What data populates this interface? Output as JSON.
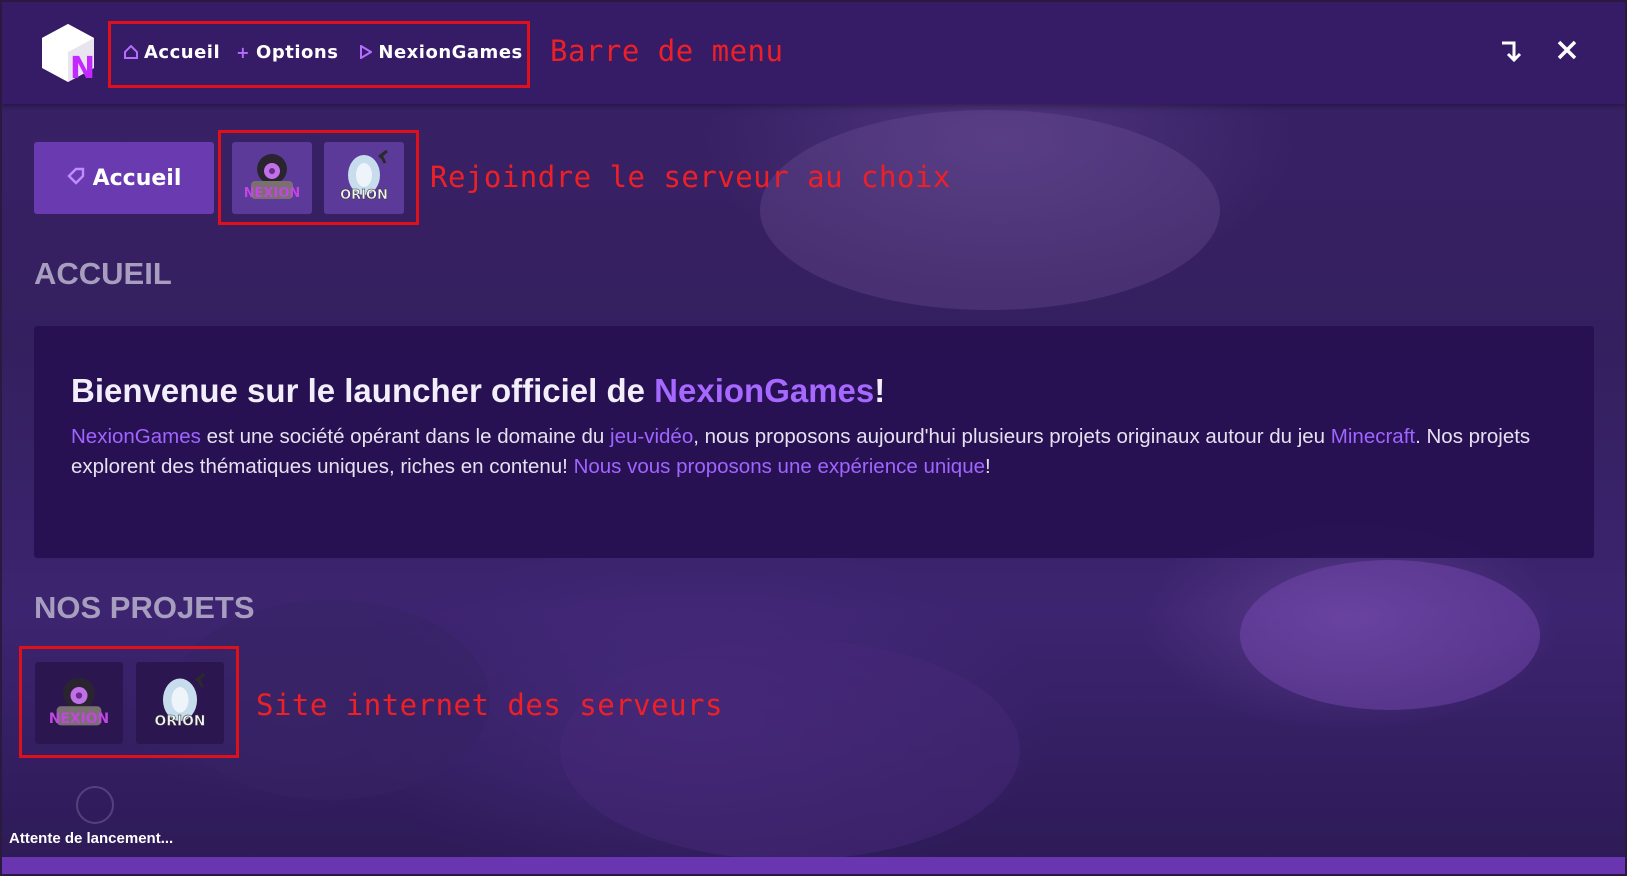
{
  "menu": {
    "items": [
      {
        "label": "Accueil",
        "icon": "home-icon"
      },
      {
        "label": "Options",
        "icon": "plus-icon"
      },
      {
        "label": "NexionGames",
        "icon": "play-icon"
      }
    ]
  },
  "window": {
    "minimize_icon": "arrow-down-icon",
    "close_icon": "close-icon"
  },
  "annotations": {
    "menu_bar": "Barre de menu",
    "join_server": "Rejoindre le serveur au choix",
    "websites": "Site internet des serveurs"
  },
  "tabs": {
    "home_label": "Accueil",
    "servers": [
      {
        "name": "Nexion"
      },
      {
        "name": "Orion"
      }
    ]
  },
  "home": {
    "section_title": "ACCUEIL",
    "welcome_prefix": "Bienvenue sur le launcher officiel de ",
    "welcome_brand": "NexionGames",
    "welcome_suffix": "!",
    "p_brand": "NexionGames",
    "p_text1": " est une société opérant dans le domaine du ",
    "p_link_jeu": "jeu-vidéo",
    "p_text2": ", nous proposons aujourd'hui plusieurs projets originaux autour du jeu ",
    "p_link_minecraft": "Minecraft",
    "p_text3": ". Nos projets explorent des thématiques uniques, riches en contenu! ",
    "p_link_exp": "Nous vous proposons une expérience unique",
    "p_text4": "!"
  },
  "projects": {
    "section_title": "NOS PROJETS",
    "items": [
      {
        "name": "Nexion"
      },
      {
        "name": "Orion"
      }
    ]
  },
  "status": {
    "text": "Attente de lancement..."
  },
  "colors": {
    "accent": "#a668ff",
    "annotation": "#e0101a",
    "titlebar": "#361b66"
  }
}
